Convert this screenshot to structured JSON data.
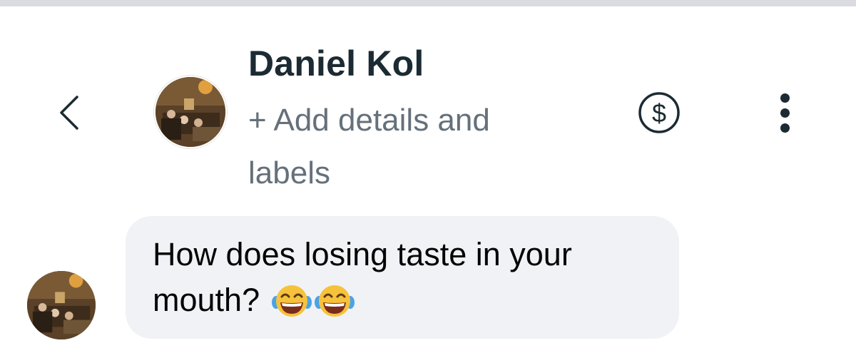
{
  "header": {
    "contact_name": "Daniel Kol",
    "add_details": "+ Add details and labels",
    "icons": {
      "back": "chevron-left-icon",
      "payment": "dollar-circle-icon",
      "more": "more-vertical-icon"
    }
  },
  "messages": [
    {
      "text": "How does losing taste in your mouth?",
      "emojis": [
        "face-with-tears-of-joy",
        "face-with-tears-of-joy"
      ]
    }
  ],
  "colors": {
    "bubble_bg": "#f0f2f5",
    "name_text": "#1c2b33",
    "secondary_text": "#65707a",
    "top_strip": "#d9dbe0"
  }
}
